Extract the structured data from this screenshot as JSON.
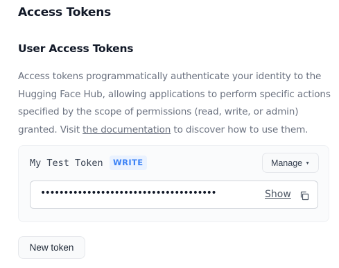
{
  "page": {
    "title": "Access Tokens"
  },
  "section": {
    "title": "User Access Tokens",
    "description": {
      "line1": "Access tokens programmatically authenticate your identity to the",
      "line2": "Hugging Face Hub, allowing applications to perform specific actions",
      "line3": "specified by the scope of permissions (read, write, or admin)",
      "line4_before": "granted. Visit ",
      "link_text": "the documentation",
      "line4_after": " to discover how to use them."
    }
  },
  "token": {
    "name": "My Test Token",
    "permission": "WRITE",
    "manage_label": "Manage",
    "manage_icon": "caret-down-icon",
    "masked_value": "••••••••••••••••••••••••••••••••••••••",
    "show_label": "Show",
    "copy_icon": "copy-icon"
  },
  "actions": {
    "new_token_label": "New token"
  },
  "colors": {
    "badge_bg": "#eaf2ff",
    "badge_text": "#3b82f6",
    "muted_text": "#6b7280"
  }
}
